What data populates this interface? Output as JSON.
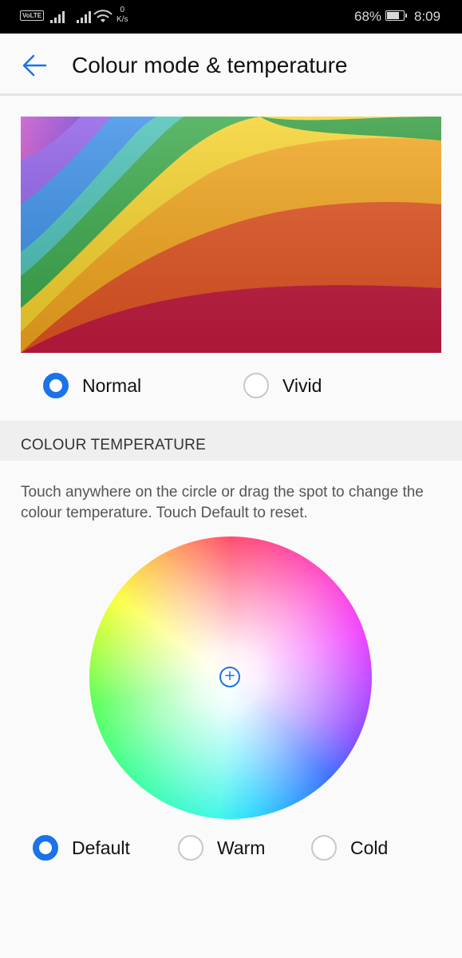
{
  "status_bar": {
    "volte_label": "VoLTE",
    "network_speed_value": "0",
    "network_speed_unit": "K/s",
    "battery_percent": "68%",
    "battery_level": 0.68,
    "time": "8:09"
  },
  "app_bar": {
    "title": "Colour mode & temperature",
    "back_icon": "arrow-left-icon",
    "accent_color": "#1a73e8"
  },
  "colour_mode": {
    "options": [
      {
        "label": "Normal",
        "selected": true
      },
      {
        "label": "Vivid",
        "selected": false
      }
    ]
  },
  "colour_temperature": {
    "section_title": "COLOUR TEMPERATURE",
    "description": "Touch anywhere on the circle or drag the spot to change the colour temperature. Touch Default to reset.",
    "options": [
      {
        "label": "Default",
        "selected": true
      },
      {
        "label": "Warm",
        "selected": false
      },
      {
        "label": "Cold",
        "selected": false
      }
    ]
  }
}
